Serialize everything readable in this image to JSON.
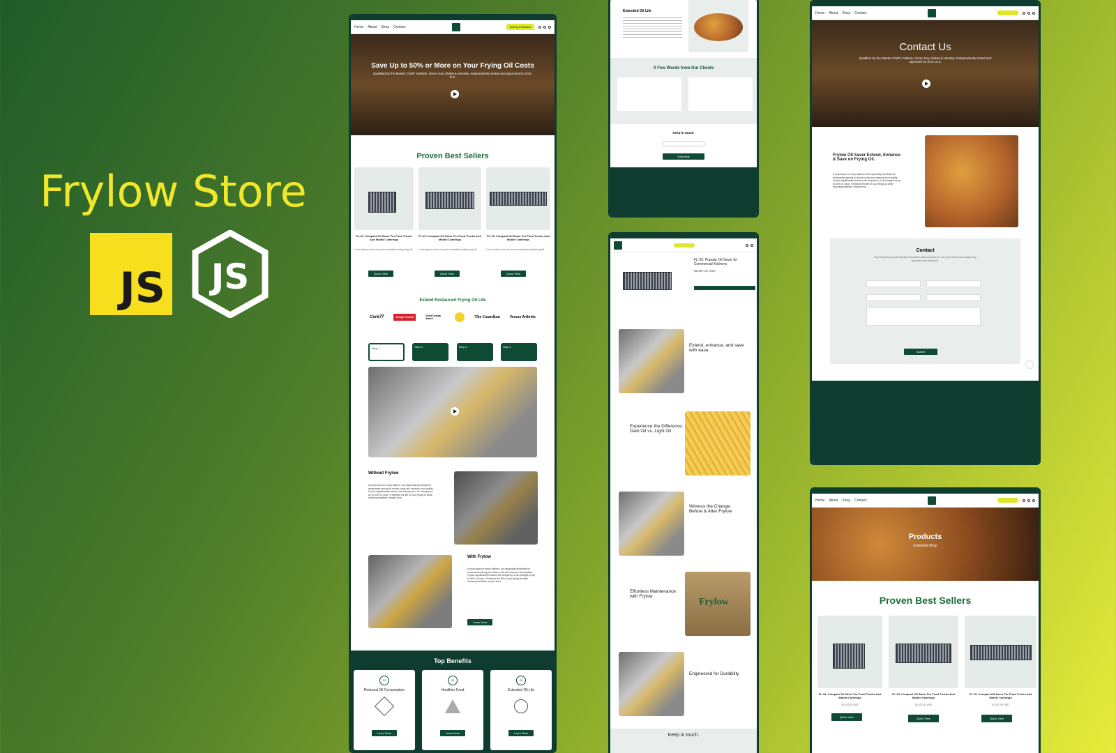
{
  "title": "Frylow Store",
  "logos": {
    "js": "JS",
    "node": "JS"
  },
  "colors": {
    "brand": "#0e3c2e",
    "accent": "#dfe72a",
    "title": "#f1e72a"
  },
  "home": {
    "nav": [
      "Home",
      "About",
      "Shop",
      "Contact"
    ],
    "cta": "Saving Estimator",
    "hero_title": "Save Up to 50% or More on Your Frying Oil Costs",
    "hero_sub": "Qualified by the Master Chefs' Institute, Green Key Global & Hensley. Independently tested and approved by SGS, B.S.",
    "best_sellers": "Proven Best Sellers",
    "products": [
      {
        "name": "FL-10: Compact Oil Saver For Food Trucks And Mobile Caterings",
        "desc": "Lorem ipsum dolor sit amet consectetur adipiscing elit.",
        "btn": "Quick View"
      },
      {
        "name": "FL-15: Compact Oil Saver For Food Trucks And Mobile Caterings",
        "desc": "Lorem ipsum dolor sit amet consectetur adipiscing elit.",
        "btn": "Quick View"
      },
      {
        "name": "FL-15: Compact Oil Saver For Food Trucks And Mobile Caterings",
        "desc": "Lorem ipsum dolor sit amet consectetur adipiscing elit.",
        "btn": "Quick View"
      }
    ],
    "extend_title": "Extend Restaurant Frying Oil Life",
    "partners": [
      "Core77",
      "Design Council",
      "Good Design Award",
      "",
      "The Guardian",
      "Versus Arthritis"
    ],
    "steps": [
      "Step 1",
      "Step 2",
      "Step 3",
      "Step 4"
    ],
    "without": {
      "title": "Without Frylow",
      "body": "A must-have for every kitchen, but especially beneficial for restaurants aiming to reduce costs and improve food quality. Frylow significantly reduces the frequency of oil changes by up to 50% or more. It extends the life of your frying oil while ensuring healthier, crisper food."
    },
    "with": {
      "title": "With Frylow",
      "body": "A must-have for every kitchen, but especially beneficial for restaurants aiming to reduce costs and improve food quality. Frylow significantly reduces the frequency of oil changes by up to 50% or more. It extends the life of your frying oil while ensuring healthier, crisper food.",
      "btn": "Learn More"
    },
    "benefits_title": "Top Benefits",
    "benefits": [
      {
        "num": "01",
        "name": "Reduced Oil Consumption",
        "btn": "Learn More"
      },
      {
        "num": "02",
        "name": "Healthier Food",
        "btn": "Learn More"
      },
      {
        "num": "03",
        "name": "Extended Oil Life",
        "btn": "Learn More"
      }
    ]
  },
  "about": {
    "extended": "Extended Oil Life",
    "clients_title": "A Few Words from Our Clients",
    "keep": "Keep in touch.",
    "subscribe": "Subscribe"
  },
  "product": {
    "name": "FL-25: Popular Oil Saver for Commercial Kitchens",
    "price": "$1,897.00 USD",
    "sections": [
      "Extend, enhance, and save with ease.",
      "Experience the Difference: Dark Oil vs. Light Oil",
      "Witness the Change: Before & After Frylow",
      "Effortless Maintenance with Frylow",
      "Engineered for Durability"
    ],
    "keep": "Keep in touch.",
    "box_brand": "Frylow"
  },
  "contact": {
    "nav": [
      "Home",
      "About",
      "Shop",
      "Contact"
    ],
    "hero_title": "Contact Us",
    "hero_sub": "Qualified by the Master Chefs' Institute, Green Key Global & Hensley. Independently tested and approved by SGS, B.S.",
    "intro_title": "Frylow Oil Saver Extend, Enhance & Save on Frying Oil.",
    "intro_body": "A must-have for every kitchen, but especially beneficial for restaurants aiming to reduce costs and improve food quality. Frylow significantly reduces the frequency of oil changes by up to 50% or more. It extends the life of your frying oil while ensuring healthier, crisper food.",
    "form_title": "Contact",
    "form_sub": "Don't forget to provide enough information about yourself so I can get in touch and answer any questions you may have.",
    "submit": "Submit"
  },
  "products_page": {
    "hero_title": "Products",
    "hero_sub": "Extended Shop",
    "best_sellers": "Proven Best Sellers",
    "items": [
      {
        "name": "FL-10: Compact Oil Saver For Food Trucks And Mobile Caterings",
        "price": "$1,097.00 USD",
        "btn": "Quick View"
      },
      {
        "name": "FL-15: Compact Oil Saver For Food Trucks And Mobile Caterings",
        "price": "$1,337.00 USD",
        "btn": "Quick View"
      },
      {
        "name": "FL-15: Compact Oil Saver For Food Trucks And Mobile Caterings",
        "price": "$1,397.00 USD",
        "btn": "Quick View"
      }
    ]
  }
}
